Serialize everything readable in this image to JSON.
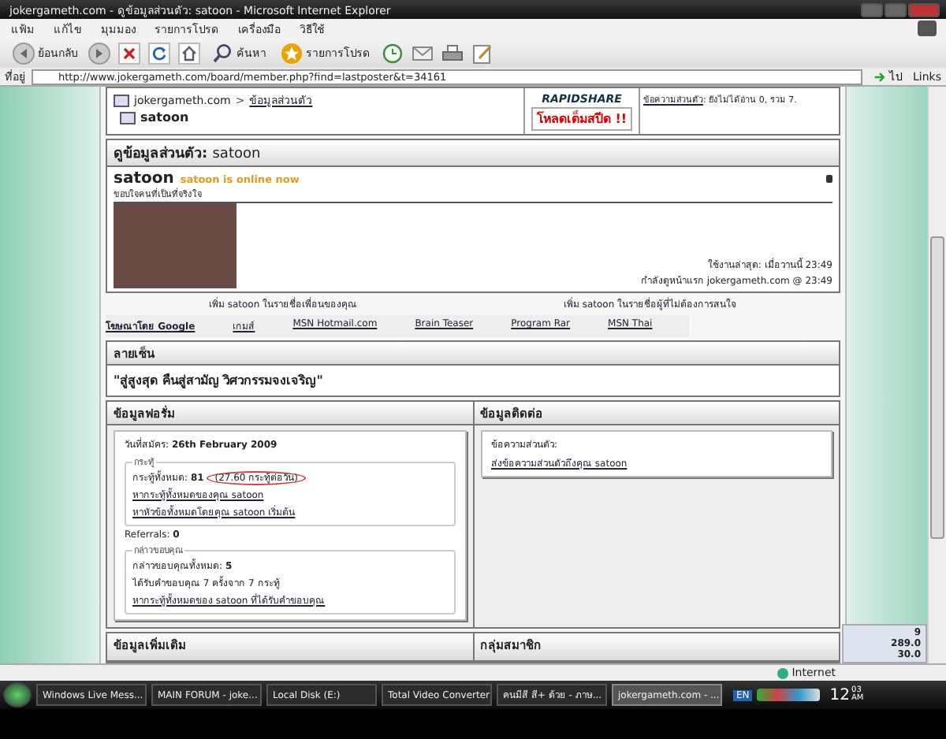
{
  "window": {
    "title": "jokergameth.com - ดูข้อมูลส่วนตัว: satoon - Microsoft Internet Explorer"
  },
  "menu": [
    "แฟ้ม",
    "แก้ไข",
    "มุมมอง",
    "รายการโปรด",
    "เครื่องมือ",
    "วิธีใช้"
  ],
  "toolbar": {
    "back_label": "ย้อนกลับ",
    "search_label": "ค้นหา",
    "favorites_label": "รายการโปรด"
  },
  "address": {
    "label": "ที่อยู่",
    "url": "http://www.jokergameth.com/board/member.php?find=lastposter&t=34161",
    "go_label": "ไป",
    "links_label": "Links"
  },
  "header": {
    "site": "jokergameth.com",
    "separator": ">",
    "breadcrumb_link": "ข้อมูลส่วนตัว",
    "username": "satoon",
    "banner_brand": "RAPIDSHARE",
    "banner_text": "โหลดเต็มสปีด !!",
    "pm_label": "ข้อความส่วนตัว",
    "pm_text": ": ยังไม่ได้อ่าน 0, รวม 7."
  },
  "profile": {
    "title_prefix": "ดูข้อมูลส่วนตัว:",
    "title_user": "satoon",
    "username": "satoon",
    "online_text": "satoon is online now",
    "user_title": "ขอบใจคนที่เป็นที่จริงใจ",
    "last_activity": "ใช้งานล่าสุด: เมื่อวานนี้ 23:49",
    "viewing": "กำลังดูหน้าแรก jokergameth.com @ 23:49",
    "add_friend": "เพิ่ม satoon ในรายชื่อเพื่อนของคุณ",
    "add_ignore": "เพิ่ม satoon ในรายชื่อผู้ที่ไม่ต้องการสนใจ"
  },
  "ad_links": [
    "โฆษณาโดย Google",
    "เกมส์",
    "MSN Hotmail.com",
    "Brain Teaser",
    "Program Rar",
    "MSN Thai"
  ],
  "signature": {
    "title": "ลายเซ็น",
    "text": "\"สู่สูงสุด คืนสู่สามัญ วิศวกรรมจงเจริญ\""
  },
  "forum_info": {
    "title": "ข้อมูลฟอรั่ม",
    "join_label": "วันที่สมัคร:",
    "join_date": "26th February 2009",
    "posts": {
      "legend": "กระทู้",
      "total_label": "กระทู้ทั้งหมด:",
      "total": "81",
      "per_day": "(27.60 กระทู้ต่อวัน)",
      "find_posts": "หากระทู้ทั้งหมดของคุณ satoon",
      "find_threads": "หาหัวข้อทั้งหมดโดยคุณ satoon เริ่มต้น"
    },
    "referrals_label": "Referrals:",
    "referrals": "0",
    "thanks": {
      "legend": "กล่าวขอบคุณ",
      "given_label": "กล่าวขอบคุณทั้งหมด:",
      "given": "5",
      "received": "ได้รับคำขอบคุณ 7 ครั้งจาก 7 กระทู้",
      "find": "หากระทู้ทั้งหมดของ satoon ที่ได้รับคำขอบคุณ"
    }
  },
  "contact": {
    "title": "ข้อมูลติดต่อ",
    "pm_label": "ข้อความส่วนตัว:",
    "pm_link": "ส่งข้อความส่วนตัวถึงคุณ satoon"
  },
  "more_titles": [
    "ข้อมูลเพิ่มเติม",
    "กลุ่มสมาชิก"
  ],
  "status": {
    "zone": "Internet"
  },
  "gadget": [
    "9",
    "289.0",
    "30.0"
  ],
  "taskbar": {
    "items": [
      {
        "label": "Windows Live Mess...",
        "selected": false
      },
      {
        "label": "MAIN FORUM - joke...",
        "selected": false
      },
      {
        "label": "Local Disk (E:)",
        "selected": false
      },
      {
        "label": "Total Video Converter",
        "selected": false
      },
      {
        "label": "คนมีสี สี+ ด้วย - ภาษ...",
        "selected": false
      },
      {
        "label": "jokergameth.com - ...",
        "selected": true
      }
    ],
    "lang": "EN",
    "clock_hour": "12",
    "clock_min": "03",
    "clock_ampm": "AM"
  }
}
